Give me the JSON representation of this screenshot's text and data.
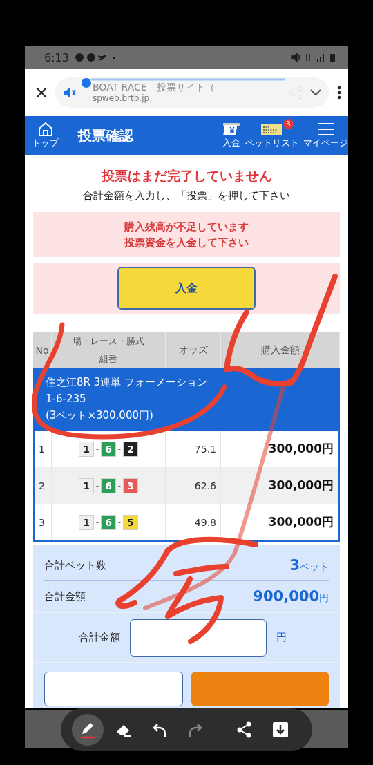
{
  "status_bar": {
    "time": "6:13"
  },
  "browser": {
    "title": "BOAT RACE　投票サイト（",
    "url": "spweb.brtb.jp"
  },
  "header": {
    "home_label": "トップ",
    "title": "投票確認",
    "actions": [
      {
        "kind": "deposit",
        "label": "入金"
      },
      {
        "kind": "betlist",
        "label": "ベットリスト",
        "badge": "3"
      },
      {
        "kind": "menu",
        "label": "マイページ"
      }
    ]
  },
  "notice": {
    "title": "投票はまだ完了していません",
    "subtitle": "合計金額を入力し、「投票」を押して下さい"
  },
  "alert": {
    "lines": [
      "購入残高が不足しています",
      "投票資金を入金して下さい"
    ]
  },
  "deposit_button": "入金",
  "table": {
    "columns": {
      "no": "No",
      "race_top": "場・レース・勝式",
      "race_bottom": "組番",
      "odds": "オッズ",
      "amount": "購入金額"
    },
    "separator": "-",
    "group": [
      "住之江8R 3連単 フォーメーション",
      "1-6-235",
      "(3ベット×300,000円)"
    ],
    "rows": [
      {
        "no": "1",
        "combo": [
          {
            "n": "1",
            "color": "#eeeeee"
          },
          {
            "n": "6",
            "color": "#2e9e5b"
          },
          {
            "n": "2",
            "color": "#222222"
          }
        ],
        "odds": "75.1",
        "amount": "300,000円"
      },
      {
        "no": "2",
        "combo": [
          {
            "n": "1",
            "color": "#eeeeee"
          },
          {
            "n": "6",
            "color": "#2e9e5b"
          },
          {
            "n": "3",
            "color": "#e85a5a"
          }
        ],
        "odds": "62.6",
        "amount": "300,000円"
      },
      {
        "no": "3",
        "combo": [
          {
            "n": "1",
            "color": "#eeeeee"
          },
          {
            "n": "6",
            "color": "#2e9e5b"
          },
          {
            "n": "5",
            "color": "#f5d93a"
          }
        ],
        "odds": "49.8",
        "amount": "300,000円"
      }
    ]
  },
  "summary": {
    "bets_label": "合計ベット数",
    "bets_value": "3",
    "bets_unit": "ベット",
    "total_label": "合計金額",
    "total_value": "900,000",
    "total_unit": "円"
  },
  "amount_input": {
    "label": "合計金額",
    "unit": "円"
  },
  "buttons": [
    {
      "kind": "secondary"
    },
    {
      "kind": "primary"
    }
  ],
  "toolbar": [
    {
      "kind": "pen",
      "selected": true,
      "disabled": false
    },
    {
      "kind": "eraser",
      "selected": false,
      "disabled": false
    },
    {
      "kind": "undo",
      "selected": false,
      "disabled": false
    },
    {
      "kind": "redo",
      "selected": false,
      "disabled": true
    },
    {
      "kind": "share",
      "selected": false,
      "disabled": false
    },
    {
      "kind": "save",
      "selected": false,
      "disabled": false
    }
  ]
}
